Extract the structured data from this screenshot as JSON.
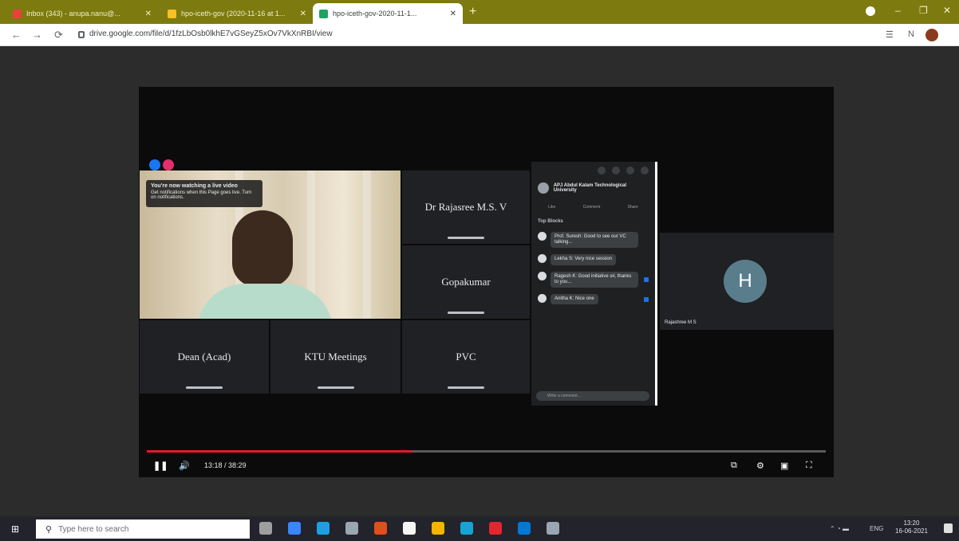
{
  "browser": {
    "tabs": [
      {
        "title": "Inbox (343) - anupa.nanu@...",
        "fav_color": "#e8413b"
      },
      {
        "title": "hpo-iceth-gov (2020-11-16 at 1...",
        "fav_color": "#f6c026"
      },
      {
        "title": "hpo-iceth-gov-2020-11-1...",
        "fav_color": "#1ea362"
      }
    ],
    "new_tab_symbol": "+",
    "window_controls": [
      "–",
      "❐",
      "✕"
    ],
    "url": "drive.google.com/file/d/1fzLbOsb0lkhE7vGSeyZ5xOv7VkXnRBI/view",
    "nav_icons": [
      "←",
      "→",
      "⟳"
    ],
    "ext_icons": [
      "☰",
      "N"
    ]
  },
  "participants": {
    "tiles": [
      {
        "label": "Dr Rajasree M.S. V"
      },
      {
        "label": "Gopakumar"
      },
      {
        "label": "Dean (Acad)"
      },
      {
        "label": "KTU Meetings"
      },
      {
        "label": "PVC"
      }
    ],
    "side": {
      "initial": "H",
      "name": "Rajashree M S"
    }
  },
  "notice": {
    "title": "You're now watching a live video",
    "body": "Get notifications when this Page goes live. Turn on notifications."
  },
  "chat": {
    "host_name": "APJ Abdul Kalam Technological University",
    "actions": [
      "Like",
      "Comment",
      "Share"
    ],
    "heading": "Top Blocks",
    "messages": [
      {
        "text": "Prof. Suresh: Good to see our VC talking..."
      },
      {
        "text": "Lekha S: Very nice session"
      },
      {
        "text": "Ragesh K: Good initiative sir, thanks to you..."
      },
      {
        "text": "Anitha K: Nice one"
      }
    ],
    "input_placeholder": "Write a comment..."
  },
  "controls": {
    "play_icon": "❚❚",
    "volume_icon": "🔊",
    "time": "13:18 / 38:29",
    "progress": 0.39,
    "right_icons": [
      "⧉",
      "⚙",
      "▣",
      "⛶"
    ]
  },
  "taskbar": {
    "start_icon": "⊞",
    "search_placeholder": "Type here to search",
    "icons": [
      "#9e9e9e",
      "#3a86ff",
      "#1ba1e2",
      "#9aa6b2",
      "#e04f1a",
      "#f5f5f5",
      "#f4b400",
      "#16a3d6",
      "#e3262f",
      "#0078d7",
      "#9aa6b2"
    ],
    "tray_text": "ENG",
    "time": "13:20",
    "date": "16-06-2021"
  }
}
